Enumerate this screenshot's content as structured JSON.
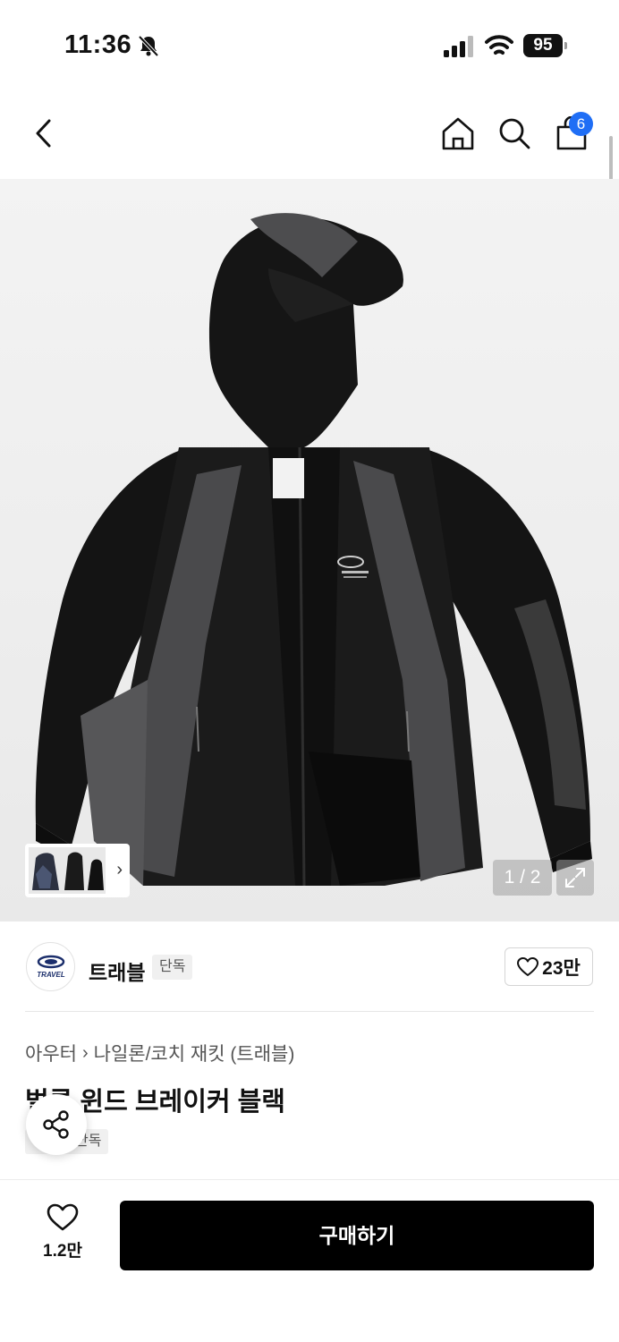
{
  "status_bar": {
    "time": "11:36",
    "battery": "95"
  },
  "nav": {
    "cart_count": "6"
  },
  "gallery": {
    "counter": "1 / 2"
  },
  "brand": {
    "name": "트래블",
    "logo_text": "TRAVEL",
    "badge": "단독",
    "likes": "23만"
  },
  "product": {
    "breadcrumb": [
      "아우터",
      "나일론/코치 재킷 (트래블)"
    ],
    "title": "벌룬 윈드 브레이커 블랙",
    "badge": "단독"
  },
  "bottom": {
    "wish_count": "1.2만",
    "buy_label": "구매하기"
  },
  "colors": {
    "accent": "#1f6ef5",
    "buy_button": "#000000"
  }
}
